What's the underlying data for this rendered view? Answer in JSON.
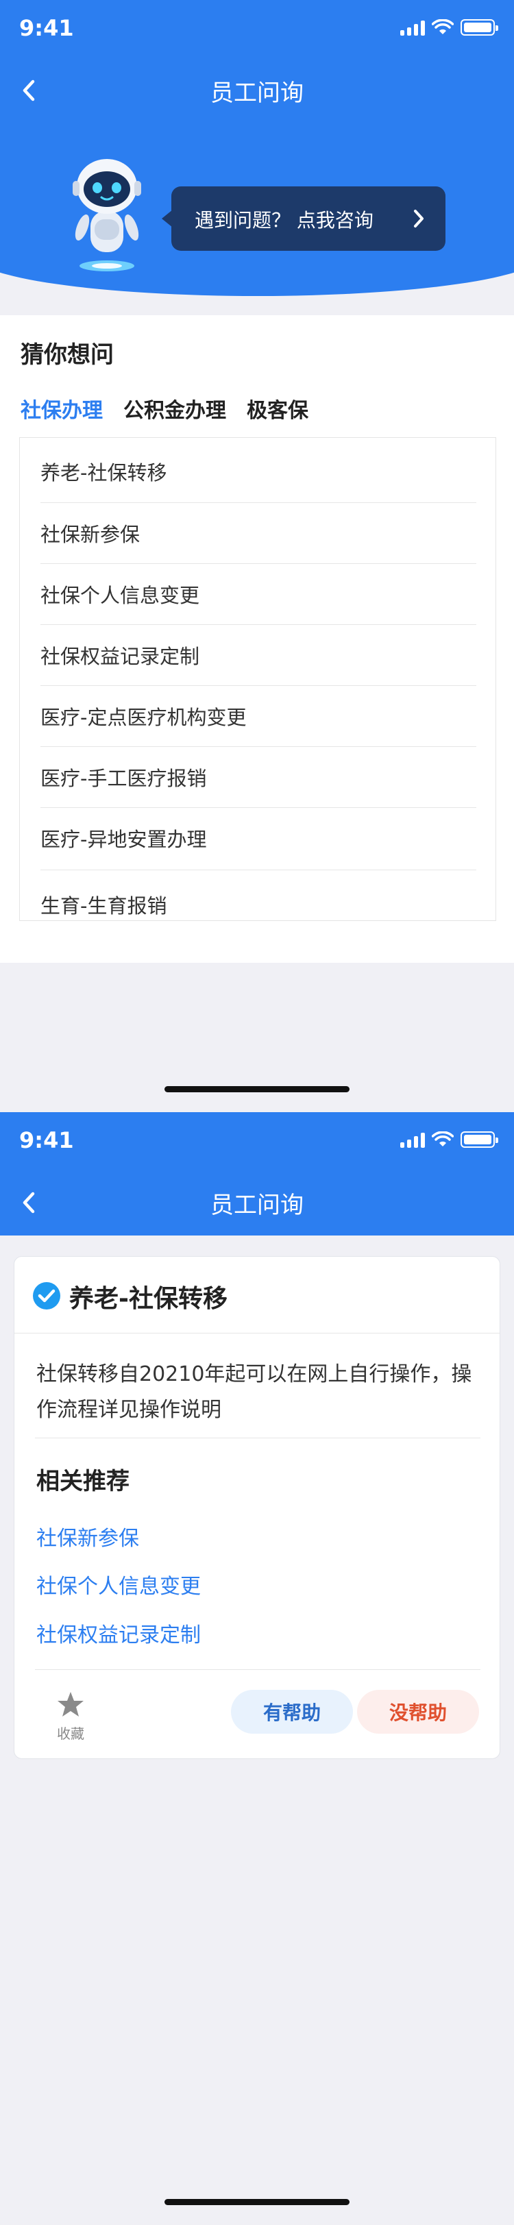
{
  "status": {
    "time": "9:41"
  },
  "screen1": {
    "nav_title": "员工问询",
    "bubble_text": "遇到问题？ 点我咨询",
    "guess_title": "猜你想问",
    "tabs": [
      {
        "label": "社保办理",
        "active": true
      },
      {
        "label": "公积金办理",
        "active": false
      },
      {
        "label": "极客保",
        "active": false
      }
    ],
    "questions": [
      "养老-社保转移",
      "社保新参保",
      "社保个人信息变更",
      "社保权益记录定制",
      "医疗-定点医疗机构变更",
      "医疗-手工医疗报销",
      "医疗-异地安置办理",
      "生育-生育报销"
    ]
  },
  "screen2": {
    "nav_title": "员工问询",
    "card_title": "养老-社保转移",
    "answer": "社保转移自20210年起可以在网上自行操作，操作流程详见操作说明",
    "related_title": "相关推荐",
    "related": [
      "社保新参保",
      "社保个人信息变更",
      "社保权益记录定制"
    ],
    "favorite_label": "收藏",
    "helpful_label": "有帮助",
    "not_helpful_label": "没帮助"
  },
  "colors": {
    "primary": "#2c7ef0",
    "bubble": "#1d3a6a",
    "danger": "#e0502e"
  },
  "icons": [
    "back-icon",
    "signal-icon",
    "wifi-icon",
    "battery-icon",
    "robot-icon",
    "chevron-right-icon",
    "check-circle-icon",
    "star-icon"
  ]
}
